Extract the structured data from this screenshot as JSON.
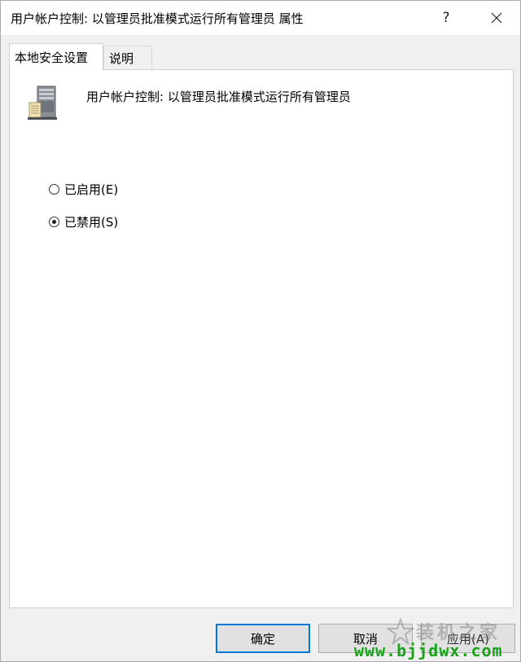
{
  "window": {
    "title": "用户帐户控制: 以管理员批准模式运行所有管理员 属性",
    "help_label": "?"
  },
  "tabs": [
    {
      "label": "本地安全设置",
      "active": true
    },
    {
      "label": "说明",
      "active": false
    }
  ],
  "policy": {
    "icon": "server-icon",
    "name": "用户帐户控制: 以管理员批准模式运行所有管理员"
  },
  "options": [
    {
      "label": "已启用(E)",
      "checked": false
    },
    {
      "label": "已禁用(S)",
      "checked": true
    }
  ],
  "buttons": {
    "ok": "确定",
    "cancel": "取消",
    "apply": "应用(A)"
  },
  "watermark": {
    "brand": "装机之家",
    "url": "www.bjjdwx.com"
  },
  "colors": {
    "accent": "#0078d7",
    "watermark_url": "#1aa31a"
  }
}
